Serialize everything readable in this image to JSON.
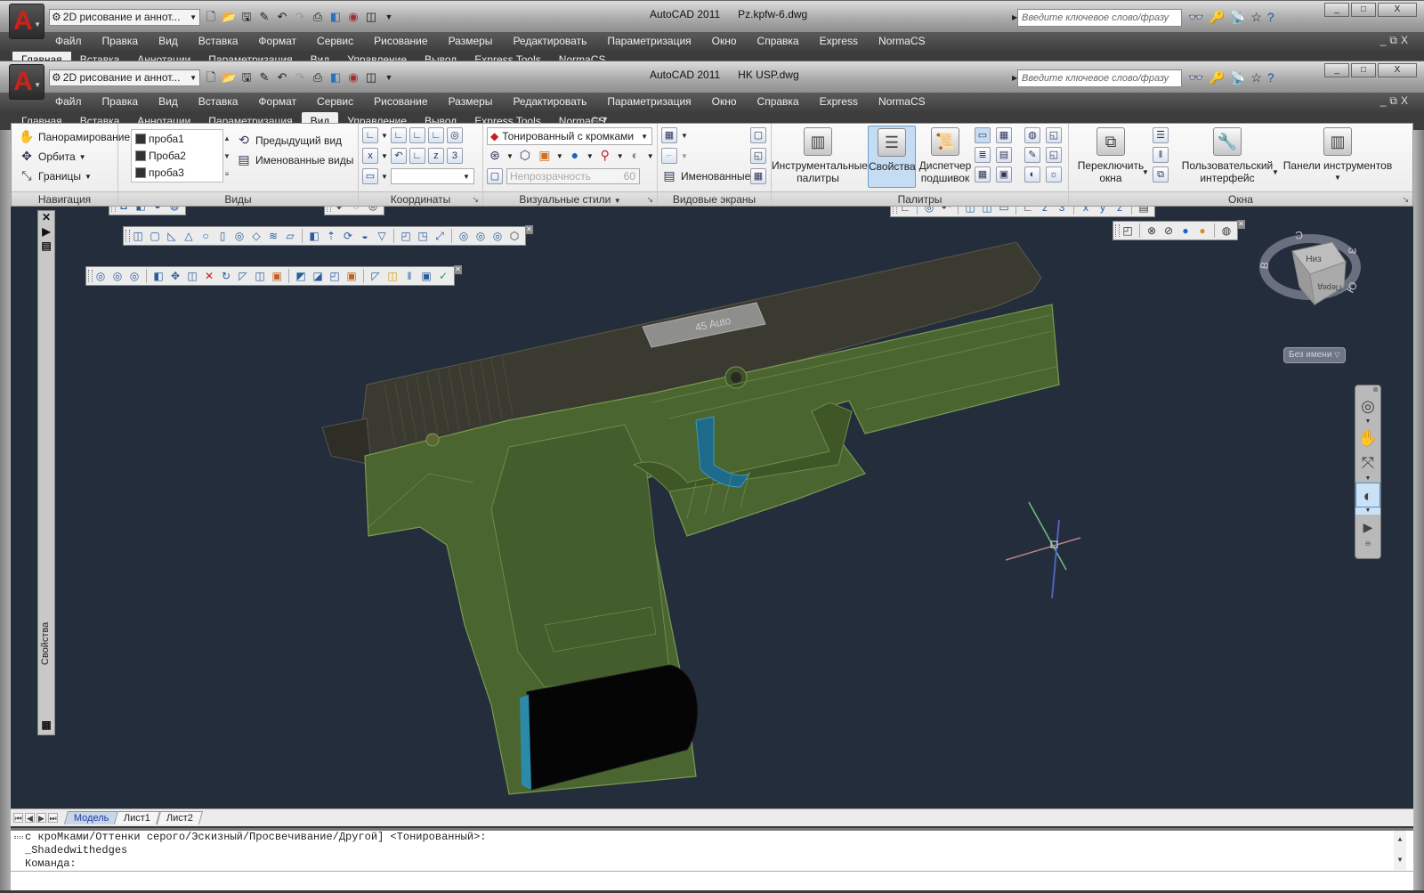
{
  "back_window": {
    "workspace": "2D рисование и аннот...",
    "app_title": "AutoCAD 2011",
    "file_name": "Pz.kpfw-6.dwg",
    "search_placeholder": "Введите ключевое слово/фразу",
    "menu": [
      "Файл",
      "Правка",
      "Вид",
      "Вставка",
      "Формат",
      "Сервис",
      "Рисование",
      "Размеры",
      "Редактировать",
      "Параметризация",
      "Окно",
      "Справка",
      "Express",
      "NormaCS"
    ],
    "ribbon_tabs": [
      "Главная",
      "Вставка",
      "Аннотации",
      "Параметризация",
      "Вид",
      "Управление",
      "Вывод",
      "Express Tools",
      "NormaCS"
    ],
    "active_tab": "Главная"
  },
  "window": {
    "workspace": "2D рисование и аннот...",
    "app_title": "AutoCAD 2011",
    "file_name": "HK USP.dwg",
    "search_placeholder": "Введите ключевое слово/фразу",
    "menu": [
      "Файл",
      "Правка",
      "Вид",
      "Вставка",
      "Формат",
      "Сервис",
      "Рисование",
      "Размеры",
      "Редактировать",
      "Параметризация",
      "Окно",
      "Справка",
      "Express",
      "NormaCS"
    ],
    "ribbon_tabs": [
      "Главная",
      "Вставка",
      "Аннотации",
      "Параметризация",
      "Вид",
      "Управление",
      "Вывод",
      "Express Tools",
      "NormaCS"
    ],
    "active_tab": "Вид",
    "mdi_controls": "_ ⧉ X"
  },
  "ribbon": {
    "navigation": {
      "title": "Навигация",
      "pan": "Панорамирование",
      "orbit": "Орбита",
      "extents": "Границы"
    },
    "views": {
      "title": "Виды",
      "list": [
        "проба1",
        "Проба2",
        "проба3"
      ],
      "previous_view": "Предыдущий вид",
      "named_views": "Именованные виды"
    },
    "coordinates": {
      "title": "Координаты"
    },
    "visual_styles": {
      "title": "Визуальные стили",
      "current_style": "Тонированный с кромками",
      "opacity_label": "Непрозрачность",
      "opacity_value": "60"
    },
    "viewports": {
      "title": "Видовые экраны",
      "named": "Именованные"
    },
    "palettes": {
      "title": "Палитры",
      "tool_palettes": "Инструментальные палитры",
      "properties": "Свойства",
      "sheet_set": "Диспетчер подшивок"
    },
    "windows": {
      "title": "Окна",
      "switch_windows": "Переключить окна",
      "user_interface": "Пользовательский интерфейс",
      "toolbars": "Панели инструментов"
    }
  },
  "viewport": {
    "properties_palette_label": "Свойства",
    "viewcube": {
      "face_top": "Низ",
      "face_front": "Перед",
      "compass_n": "С",
      "compass_e": "В",
      "compass_s": "Ю",
      "compass_w": "З",
      "ucs_name": "Без имени"
    },
    "slide_engraving": "45 Auto"
  },
  "layout_tabs": {
    "tabs": [
      "Модель",
      "Лист1",
      "Лист2"
    ],
    "active": "Модель"
  },
  "command_line": {
    "history": [
      "с кроМками/Оттенки серого/Эскизный/Просвечивание/Другой] <Тонированный>:",
      "_Shadedwithedges",
      "Команда:"
    ],
    "input": ""
  },
  "colors": {
    "viewport_bg": "#242d3c",
    "model_green": "#4b6530",
    "slide_dark": "#3a3a30",
    "trigger_blue": "#1d6a8a",
    "selection_blue": "#c5dcf2"
  }
}
